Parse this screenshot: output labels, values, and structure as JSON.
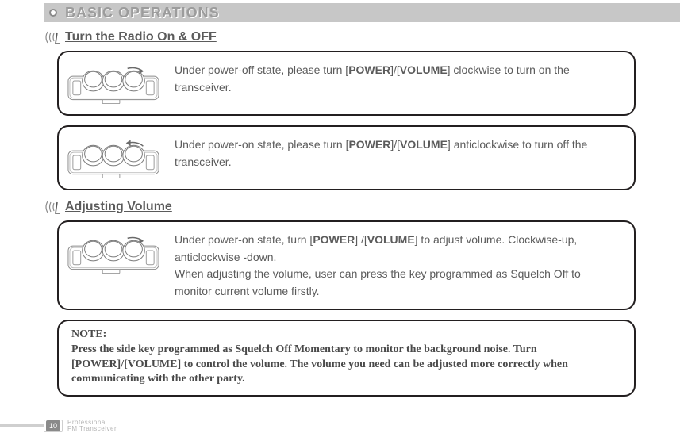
{
  "banner": {
    "title": "BASIC OPERATIONS"
  },
  "section1": {
    "heading": "Turn the Radio On & OFF",
    "card1": {
      "pre": "Under power-off state, please turn [",
      "kw1": "POWER",
      "mid": "]/[",
      "kw2": "VOLUME",
      "post": "] clockwise to turn on the transceiver."
    },
    "card2": {
      "pre": "Under power-on state, please turn [",
      "kw1": "POWER",
      "mid": "]/[",
      "kw2": "VOLUME",
      "post": "] anticlockwise to turn off the transceiver."
    }
  },
  "section2": {
    "heading": "Adjusting Volume",
    "card1": {
      "line1_pre": "Under power-on state, turn [",
      "line1_kw1": "POWER",
      "line1_mid": "] /[",
      "line1_kw2": "VOLUME",
      "line1_post": "] to adjust volume. Clockwise-up, anticlockwise -down.",
      "line2": "When adjusting the volume, user can press the key programmed as Squelch Off to monitor current volume firstly."
    }
  },
  "note": {
    "label": "NOTE:",
    "body": "Press the side key programmed as Squelch Off Momentary to monitor the background noise. Turn [POWER]/[VOLUME] to control the volume. The volume you need can be adjusted more correctly when communicating with the other party."
  },
  "footer": {
    "page": "10",
    "brand1": "Professional",
    "brand2": "FM Transceiver"
  }
}
